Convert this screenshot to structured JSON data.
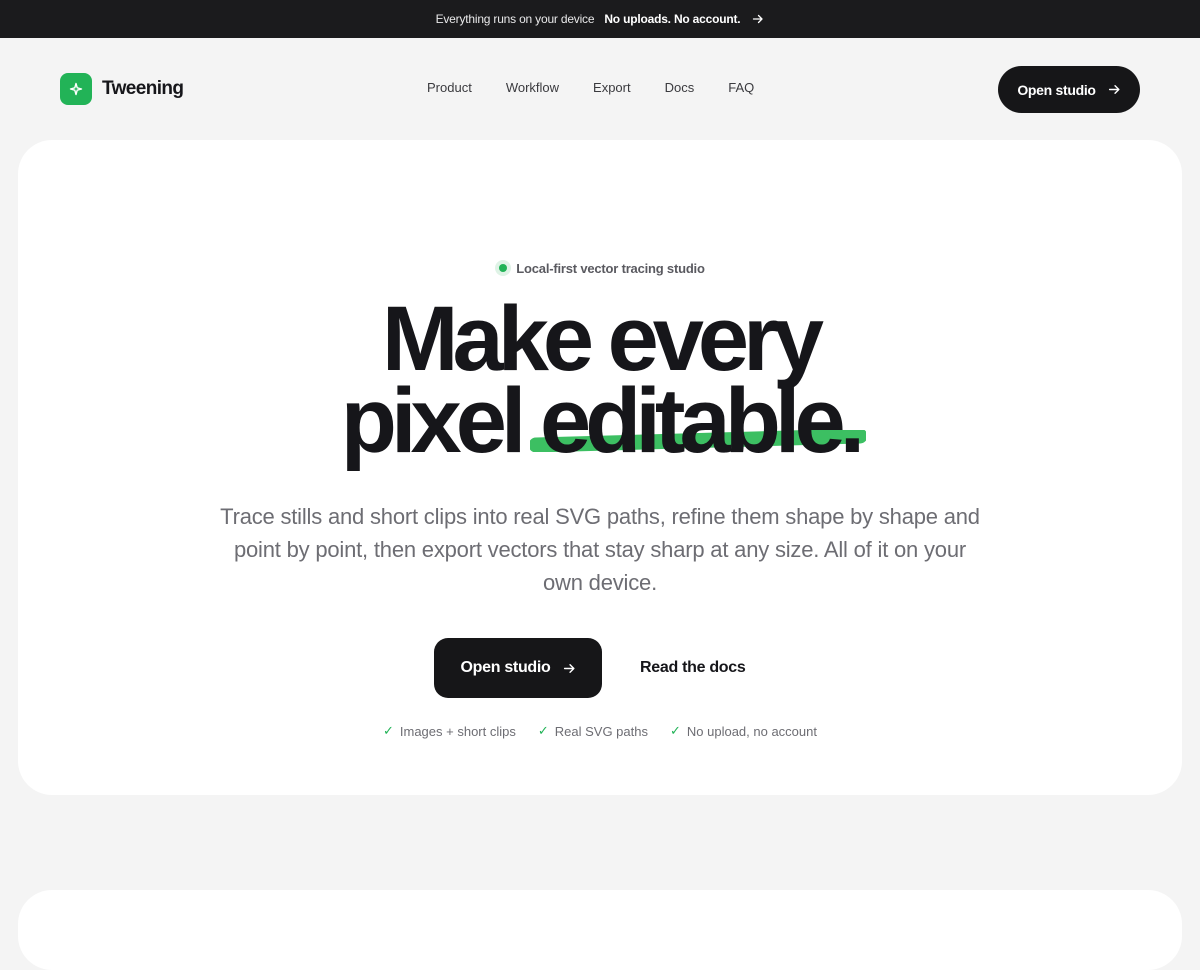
{
  "announcement": {
    "text": "Everything runs on your device",
    "highlight": "No uploads. No account."
  },
  "brand": {
    "name": "Tweening",
    "color": "#22b357"
  },
  "nav": {
    "items": [
      {
        "label": "Product"
      },
      {
        "label": "Workflow"
      },
      {
        "label": "Export"
      },
      {
        "label": "Docs"
      },
      {
        "label": "FAQ"
      }
    ]
  },
  "header": {
    "cta_label": "Open studio"
  },
  "hero": {
    "badge": "Local-first vector tracing studio",
    "headline_line1": "Make every",
    "headline_line2_plain": "pixel",
    "headline_line2_accent": "editable.",
    "subtitle": "Trace stills and short clips into real SVG paths, refine them shape by shape and point by point, then export vectors that stay sharp at any size. All of it on your own device.",
    "primary_cta": "Open studio",
    "secondary_cta": "Read the docs",
    "features": [
      {
        "label": "Images + short clips"
      },
      {
        "label": "Real SVG paths"
      },
      {
        "label": "No upload, no account"
      }
    ]
  },
  "icons": {
    "logo": "sparkle-icon",
    "arrow": "arrow-right-icon",
    "check": "check-icon"
  }
}
